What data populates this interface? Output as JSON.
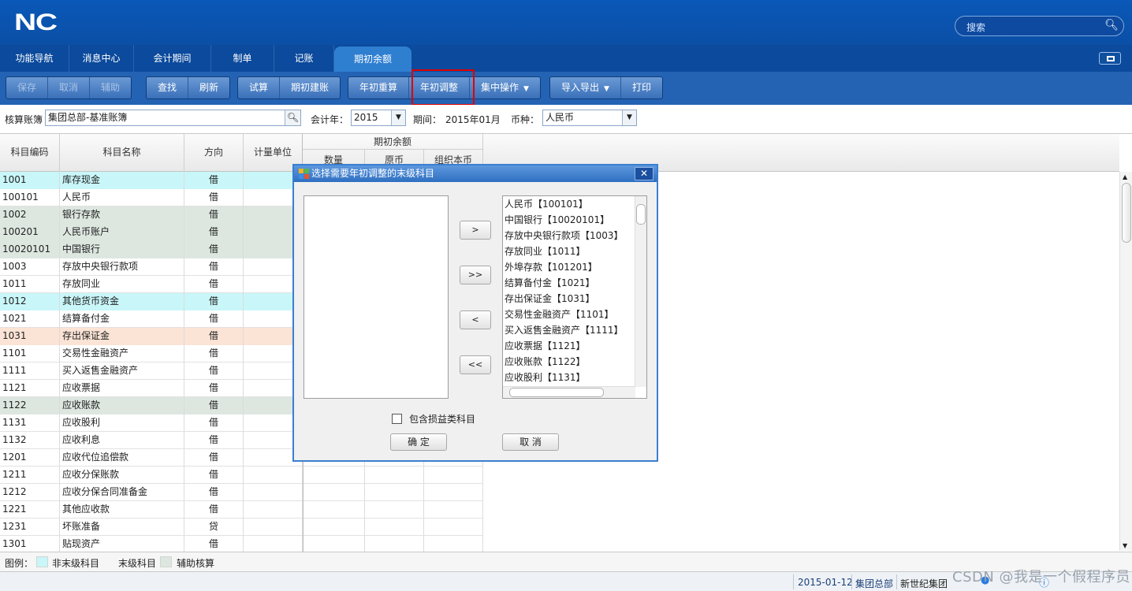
{
  "header": {
    "logo": "NC",
    "search_placeholder": "搜索"
  },
  "nav": {
    "tabs": [
      "功能导航",
      "消息中心",
      "会计期间",
      "制单",
      "记账",
      "期初余额"
    ]
  },
  "toolbar": {
    "save": "保存",
    "cancel": "取消",
    "assist": "辅助",
    "find": "查找",
    "refresh": "刷新",
    "trial": "试算",
    "init_build": "期初建账",
    "year_reaccount": "年初重算",
    "year_adjust": "年初调整",
    "batch_ops": "集中操作",
    "import_export": "导入导出",
    "print": "打印"
  },
  "filter": {
    "ledger_label": "核算账簿",
    "ledger_value": "集团总部-基准账簿",
    "year_label": "会计年：",
    "year_value": "2015",
    "period_label": "期间：",
    "period_value": "2015年01月",
    "currency_label": "币种：",
    "currency_value": "人民币"
  },
  "grid": {
    "headers": {
      "code": "科目编码",
      "name": "科目名称",
      "direction": "方向",
      "unit": "计量单位",
      "opening": "期初余额",
      "qty": "数量",
      "orig": "原币",
      "org": "组织本币"
    },
    "rows": [
      {
        "code": "1001",
        "name": "库存现金",
        "dir": "借",
        "style": "cyan"
      },
      {
        "code": "100101",
        "name": "人民币",
        "dir": "借",
        "style": ""
      },
      {
        "code": "1002",
        "name": "银行存款",
        "dir": "借",
        "style": "green"
      },
      {
        "code": "100201",
        "name": "人民币账户",
        "dir": "借",
        "style": "green"
      },
      {
        "code": "10020101",
        "name": "中国银行",
        "dir": "借",
        "style": "green"
      },
      {
        "code": "1003",
        "name": "存放中央银行款项",
        "dir": "借",
        "style": ""
      },
      {
        "code": "1011",
        "name": "存放同业",
        "dir": "借",
        "style": ""
      },
      {
        "code": "1012",
        "name": "其他货币资金",
        "dir": "借",
        "style": "cyan"
      },
      {
        "code": "1021",
        "name": "结算备付金",
        "dir": "借",
        "style": ""
      },
      {
        "code": "1031",
        "name": "存出保证金",
        "dir": "借",
        "style": "peach"
      },
      {
        "code": "1101",
        "name": "交易性金融资产",
        "dir": "借",
        "style": ""
      },
      {
        "code": "1111",
        "name": "买入返售金融资产",
        "dir": "借",
        "style": ""
      },
      {
        "code": "1121",
        "name": "应收票据",
        "dir": "借",
        "style": ""
      },
      {
        "code": "1122",
        "name": "应收账款",
        "dir": "借",
        "style": "green"
      },
      {
        "code": "1131",
        "name": "应收股利",
        "dir": "借",
        "style": ""
      },
      {
        "code": "1132",
        "name": "应收利息",
        "dir": "借",
        "style": ""
      },
      {
        "code": "1201",
        "name": "应收代位追偿款",
        "dir": "借",
        "style": ""
      },
      {
        "code": "1211",
        "name": "应收分保账款",
        "dir": "借",
        "style": ""
      },
      {
        "code": "1212",
        "name": "应收分保合同准备金",
        "dir": "借",
        "style": ""
      },
      {
        "code": "1221",
        "name": "其他应收款",
        "dir": "借",
        "style": ""
      },
      {
        "code": "1231",
        "name": "坏账准备",
        "dir": "贷",
        "style": ""
      },
      {
        "code": "1301",
        "name": "贴现资产",
        "dir": "借",
        "style": ""
      }
    ]
  },
  "legend": {
    "label": "图例：",
    "non_leaf": "非末级科目",
    "leaf": "末级科目",
    "aux": "辅助核算"
  },
  "status": {
    "date": "2015-01-12",
    "org": "集团总部",
    "group": "新世纪集团"
  },
  "watermark": "CSDN @我是一个假程序员",
  "dialog": {
    "title": "选择需要年初调整的末级科目",
    "right_items": [
      "人民币【100101】",
      "中国银行【10020101】",
      "存放中央银行款项【1003】",
      "存放同业【1011】",
      "外埠存款【101201】",
      "结算备付金【1021】",
      "存出保证金【1031】",
      "交易性金融资产【1101】",
      "买入返售金融资产【1111】",
      "应收票据【1121】",
      "应收账款【1122】",
      "应收股利【1131】"
    ],
    "move_right": ">",
    "move_all_right": ">>",
    "move_left": "<",
    "move_all_left": "<<",
    "include_label": "包含损益类科目",
    "ok": "确 定",
    "cancel": "取 消"
  },
  "colors": {
    "cyan": "#c9f6f9",
    "green": "#dde7e0",
    "peach": "#fbe3d5",
    "header_blue": "#0b4fa6"
  }
}
